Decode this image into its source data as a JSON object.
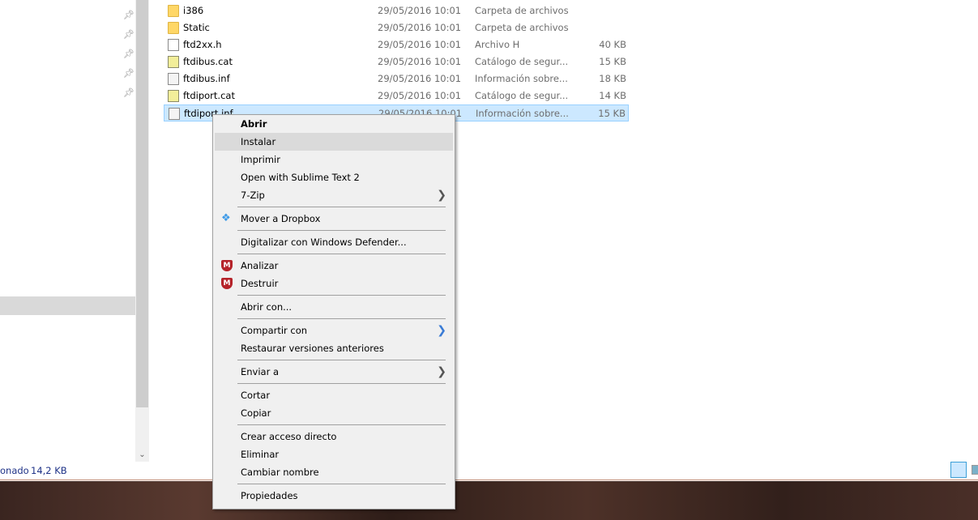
{
  "files": [
    {
      "name": "i386",
      "date": "29/05/2016 10:01",
      "type": "Carpeta de archivos",
      "size": "",
      "icon": "folder-icon"
    },
    {
      "name": "Static",
      "date": "29/05/2016 10:01",
      "type": "Carpeta de archivos",
      "size": "",
      "icon": "folder-icon"
    },
    {
      "name": "ftd2xx.h",
      "date": "29/05/2016 10:01",
      "type": "Archivo H",
      "size": "40 KB",
      "icon": "file-icon"
    },
    {
      "name": "ftdibus.cat",
      "date": "29/05/2016 10:01",
      "type": "Catálogo de segur...",
      "size": "15 KB",
      "icon": "catalog-icon"
    },
    {
      "name": "ftdibus.inf",
      "date": "29/05/2016 10:01",
      "type": "Información sobre...",
      "size": "18 KB",
      "icon": "setup-info-icon"
    },
    {
      "name": "ftdiport.cat",
      "date": "29/05/2016 10:01",
      "type": "Catálogo de segur...",
      "size": "14 KB",
      "icon": "catalog-icon"
    },
    {
      "name": "ftdiport.inf",
      "date": "29/05/2016 10:01",
      "type": "Información sobre...",
      "size": "15 KB",
      "icon": "setup-info-icon"
    }
  ],
  "menu": {
    "abrir": "Abrir",
    "instalar": "Instalar",
    "imprimir": "Imprimir",
    "sublime": "Open with Sublime Text 2",
    "zip": "7-Zip",
    "dropbox": "Mover a Dropbox",
    "defender": "Digitalizar con Windows Defender...",
    "analizar": "Analizar",
    "destruir": "Destruir",
    "abrir_con": "Abrir con...",
    "compartir": "Compartir con",
    "restaurar": "Restaurar versiones anteriores",
    "enviar": "Enviar a",
    "cortar": "Cortar",
    "copiar": "Copiar",
    "acceso": "Crear acceso directo",
    "eliminar": "Eliminar",
    "cambiar": "Cambiar nombre",
    "propiedades": "Propiedades"
  },
  "status": {
    "selected": "onado",
    "size": "14,2 KB"
  }
}
